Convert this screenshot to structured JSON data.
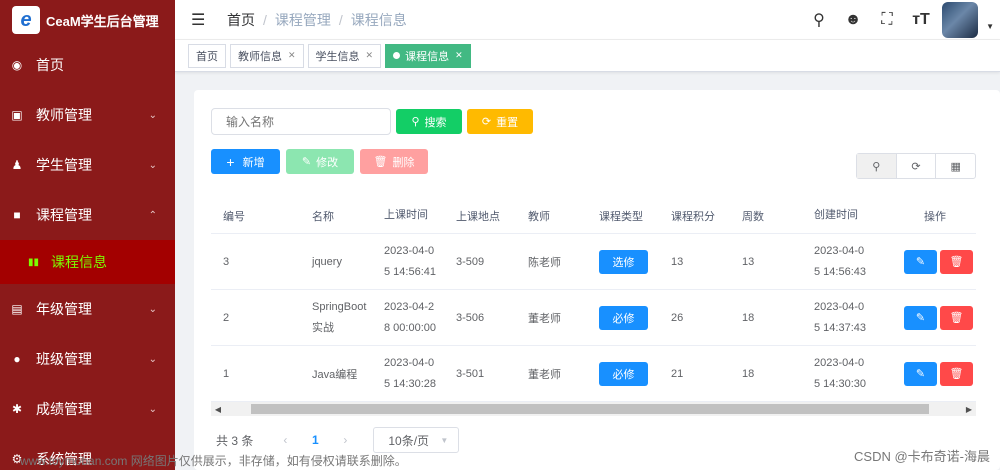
{
  "app": {
    "title": "CeaM学生后台管理",
    "logo_letter": "e"
  },
  "sidebar": {
    "items": [
      {
        "label": "首页",
        "icon": "dashboard-icon"
      },
      {
        "label": "教师管理",
        "icon": "teacher-icon"
      },
      {
        "label": "学生管理",
        "icon": "users-icon"
      },
      {
        "label": "课程管理",
        "icon": "lock-icon"
      },
      {
        "label": "课程信息",
        "icon": "course-icon"
      },
      {
        "label": "年级管理",
        "icon": "document-icon"
      },
      {
        "label": "班级管理",
        "icon": "chat-icon"
      },
      {
        "label": "成绩管理",
        "icon": "settings-icon"
      },
      {
        "label": "系统管理",
        "icon": "gear-icon"
      }
    ],
    "active_item": "课程信息"
  },
  "header": {
    "breadcrumb": [
      "首页",
      "课程管理",
      "课程信息"
    ],
    "breadcrumb_sep": "/",
    "icons": [
      "search-icon",
      "github-icon",
      "fullscreen-icon",
      "font-size-icon"
    ]
  },
  "tags": [
    {
      "label": "首页",
      "closable": false,
      "active": false
    },
    {
      "label": "教师信息",
      "closable": true,
      "active": false
    },
    {
      "label": "学生信息",
      "closable": true,
      "active": false
    },
    {
      "label": "课程信息",
      "closable": true,
      "active": true
    }
  ],
  "toolbar": {
    "search_placeholder": "输入名称",
    "search_label": "搜索",
    "reset_label": "重置",
    "add_label": "新增",
    "edit_label": "修改",
    "delete_label": "删除"
  },
  "table": {
    "columns": [
      "编号",
      "名称",
      "上课时间",
      "上课地点",
      "教师",
      "课程类型",
      "课程积分",
      "周数",
      "创建时间",
      "操作"
    ],
    "rows": [
      {
        "id": "3",
        "name": [
          "jquery"
        ],
        "time": [
          "2023-04-0",
          "5 14:56:41"
        ],
        "place": "3-509",
        "teacher": "陈老师",
        "type": "选修",
        "credit": "13",
        "weeks": "13",
        "created": [
          "2023-04-0",
          "5 14:56:43"
        ]
      },
      {
        "id": "2",
        "name": [
          "SpringBoot",
          "实战"
        ],
        "time": [
          "2023-04-2",
          "8 00:00:00"
        ],
        "place": "3-506",
        "teacher": "董老师",
        "type": "必修",
        "credit": "26",
        "weeks": "18",
        "created": [
          "2023-04-0",
          "5 14:37:43"
        ]
      },
      {
        "id": "1",
        "name": [
          "Java编程"
        ],
        "time": [
          "2023-04-0",
          "5 14:30:28"
        ],
        "place": "3-501",
        "teacher": "董老师",
        "type": "必修",
        "credit": "21",
        "weeks": "18",
        "created": [
          "2023-04-0",
          "5 14:30:30"
        ]
      }
    ]
  },
  "pagination": {
    "total_label": "共 3 条",
    "current_page": "1",
    "page_size": "10条/页"
  },
  "watermarks": {
    "left": "www.toymoban.com 网络图片仅供展示，非存储，如有侵权请联系删除。",
    "right": "CSDN @卡布奇诺-海晨"
  },
  "colors": {
    "sidebar_bg": "#8b1a1a",
    "sidebar_active_bg": "#a30000",
    "sidebar_active_text": "#7cfc00",
    "primary": "#1890ff",
    "success": "#13ce66",
    "warning": "#ffba00",
    "danger": "#ff4949",
    "tag_active": "#42b983"
  }
}
